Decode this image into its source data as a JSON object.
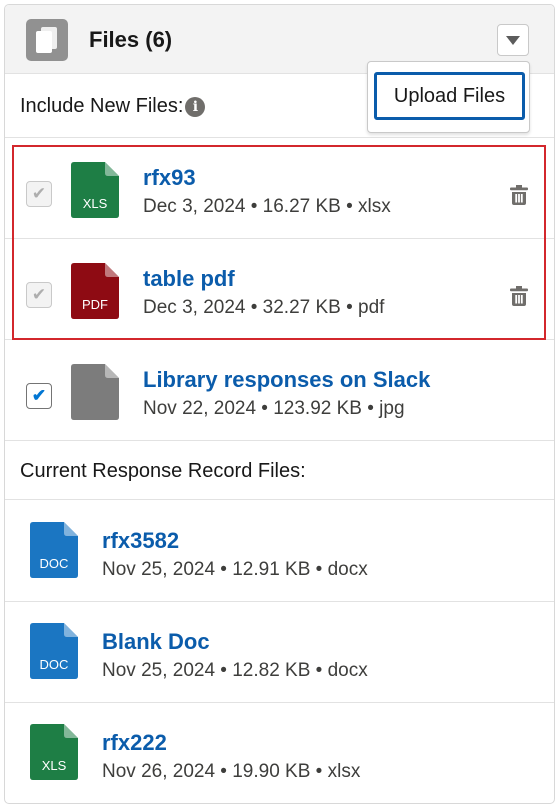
{
  "header": {
    "title": "Files (6)"
  },
  "menu": {
    "upload_label": "Upload Files"
  },
  "include_section": {
    "label": "Include New Files:",
    "info_glyph": "i"
  },
  "current_section": {
    "label": "Current Response Record Files:"
  },
  "new_files": [
    {
      "name": "rfx93",
      "meta": "Dec 3, 2024 • 16.27 KB • xlsx",
      "badge": "XLS",
      "color": "#1e7e45",
      "checked": true,
      "disabled": true,
      "delete": true
    },
    {
      "name": "table pdf",
      "meta": "Dec 3, 2024 • 32.27 KB • pdf",
      "badge": "PDF",
      "color": "#8e0b13",
      "checked": true,
      "disabled": true,
      "delete": true
    },
    {
      "name": "Library responses on Slack",
      "meta": "Nov 22, 2024 • 123.92 KB • jpg",
      "badge": "",
      "color": "#7c7c7c",
      "checked": true,
      "disabled": false,
      "delete": false
    }
  ],
  "current_files": [
    {
      "name": "rfx3582",
      "meta": "Nov 25, 2024 • 12.91 KB • docx",
      "badge": "DOC",
      "color": "#1b76c2"
    },
    {
      "name": "Blank Doc",
      "meta": "Nov 25, 2024 • 12.82 KB • docx",
      "badge": "DOC",
      "color": "#1b76c2"
    },
    {
      "name": "rfx222",
      "meta": "Nov 26, 2024 • 19.90 KB • xlsx",
      "badge": "XLS",
      "color": "#1e7e45"
    }
  ],
  "colors": {
    "accent": "#0b5cab",
    "highlight_border": "#d3272c",
    "header_bg": "#f3f3f3"
  }
}
